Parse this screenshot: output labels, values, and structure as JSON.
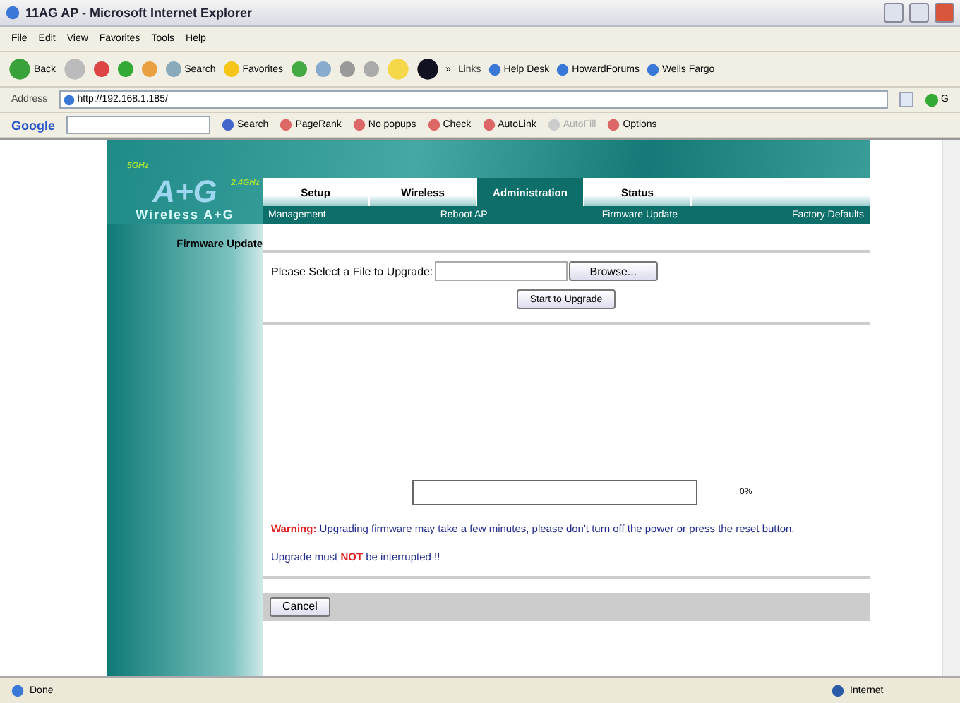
{
  "window": {
    "title": "11AG AP - Microsoft Internet Explorer"
  },
  "menu": [
    "File",
    "Edit",
    "View",
    "Favorites",
    "Tools",
    "Help"
  ],
  "toolbar": {
    "back": "Back",
    "search": "Search",
    "favorites": "Favorites",
    "more": "»"
  },
  "links": {
    "label": "Links",
    "items": [
      "Help Desk",
      "HowardForums",
      "Wells Fargo"
    ]
  },
  "address": {
    "label": "Address",
    "value": "http://192.168.1.185/",
    "go": "G"
  },
  "google_bar": {
    "logo": "Google",
    "search": "Search",
    "items": [
      {
        "label": "PageRank",
        "disabled": false
      },
      {
        "label": "No popups",
        "disabled": false
      },
      {
        "label": "Check",
        "disabled": false
      },
      {
        "label": "AutoLink",
        "disabled": false
      },
      {
        "label": "AutoFill",
        "disabled": true
      },
      {
        "label": "Options",
        "disabled": false
      }
    ]
  },
  "logo": {
    "band_5": "5GHz",
    "mark": "A+G",
    "band_24": "2.4GHz",
    "caption": "Wireless A+G"
  },
  "tabs": [
    {
      "label": "Setup",
      "selected": false
    },
    {
      "label": "Wireless",
      "selected": false
    },
    {
      "label": "Administration",
      "selected": true
    },
    {
      "label": "Status",
      "selected": false
    }
  ],
  "subtabs": [
    "Management",
    "Reboot AP",
    "Firmware Update",
    "Factory Defaults"
  ],
  "sidebar": {
    "title": "Firmware Update"
  },
  "form": {
    "label": "Please Select a File to Upgrade:",
    "browse": "Browse...",
    "start": "Start to Upgrade"
  },
  "progress": {
    "level": 0,
    "reading": "0%"
  },
  "warning": "**Warning:** Upgrading firmware may take a few minutes, please don't turn off the power or press the reset button.",
  "note": "Upgrade must **NOT** be interrupted !!",
  "cancel": "Cancel",
  "status_bar": {
    "text": "Done",
    "zone": "Internet"
  }
}
